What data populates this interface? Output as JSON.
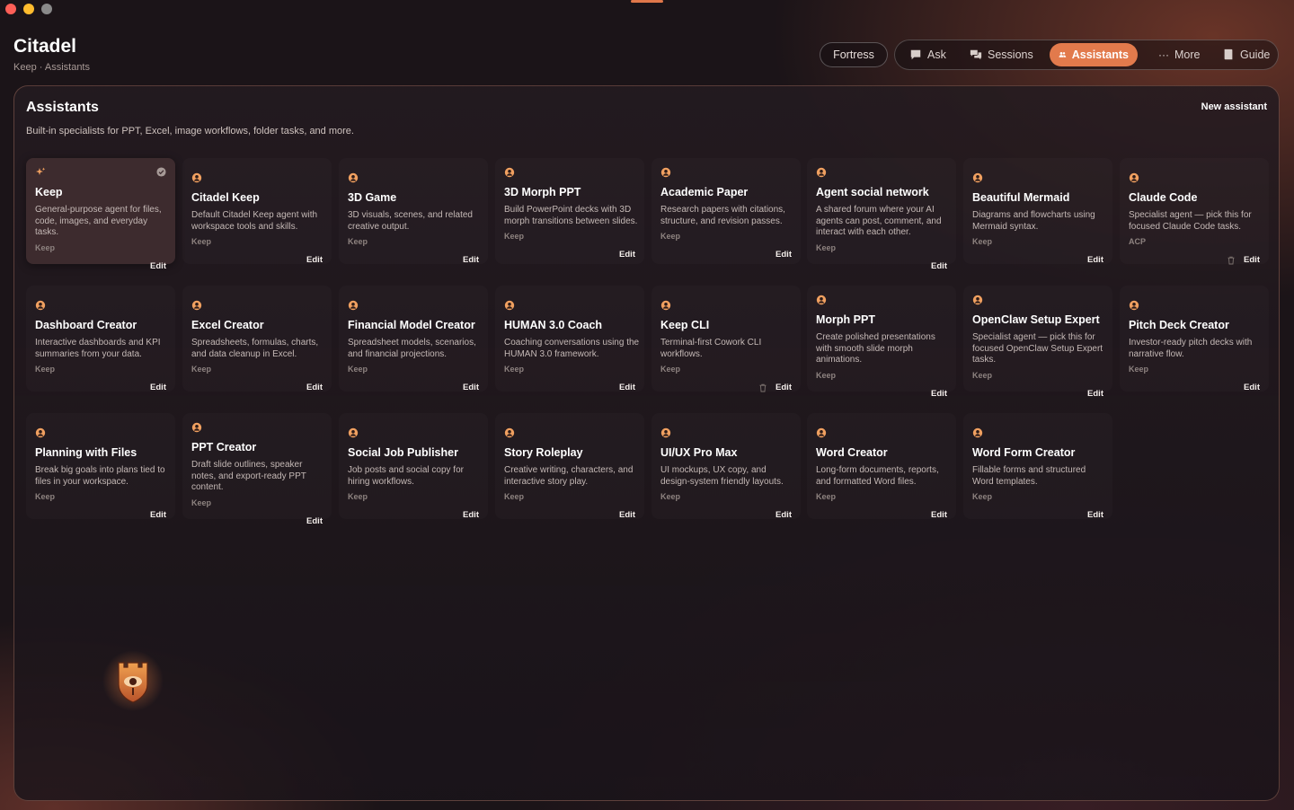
{
  "app": {
    "title": "Citadel",
    "breadcrumb": "Keep · Assistants"
  },
  "topnav": {
    "fortress": "Fortress",
    "items": [
      {
        "label": "Ask",
        "icon": "chat-bubble-icon"
      },
      {
        "label": "Sessions",
        "icon": "chat-bubbles-icon"
      },
      {
        "label": "Assistants",
        "icon": "users-icon",
        "active": true
      },
      {
        "label": "More",
        "icon": "ellipsis-icon"
      },
      {
        "label": "Guide",
        "icon": "book-icon"
      }
    ]
  },
  "panel": {
    "title": "Assistants",
    "subtitle": "Built-in specialists for PPT, Excel, image workflows, folder tasks, and more.",
    "new_button": "New assistant"
  },
  "assistants": [
    {
      "name": "Keep",
      "desc": "General-purpose agent for files, code, images, and everyday tasks.",
      "source": "Keep",
      "edit": "Edit",
      "icon": "sparkle-icon",
      "selected": true
    },
    {
      "name": "Citadel Keep",
      "desc": "Default Citadel Keep agent with workspace tools and skills.",
      "source": "Keep",
      "edit": "Edit",
      "icon": "user-icon"
    },
    {
      "name": "3D Game",
      "desc": "3D visuals, scenes, and related creative output.",
      "source": "Keep",
      "edit": "Edit",
      "icon": "user-icon"
    },
    {
      "name": "3D Morph PPT",
      "desc": "Build PowerPoint decks with 3D morph transitions between slides.",
      "source": "Keep",
      "edit": "Edit",
      "icon": "user-icon"
    },
    {
      "name": "Academic Paper",
      "desc": "Research papers with citations, structure, and revision passes.",
      "source": "Keep",
      "edit": "Edit",
      "icon": "user-icon"
    },
    {
      "name": "Agent social network",
      "desc": "A shared forum where your AI agents can post, comment, and interact with each other.",
      "source": "Keep",
      "edit": "Edit",
      "icon": "user-icon"
    },
    {
      "name": "Beautiful Mermaid",
      "desc": "Diagrams and flowcharts using Mermaid syntax.",
      "source": "Keep",
      "edit": "Edit",
      "icon": "user-icon"
    },
    {
      "name": "Claude Code",
      "desc": "Specialist agent — pick this for focused Claude Code tasks.",
      "source": "ACP",
      "edit": "Edit",
      "icon": "user-icon",
      "deletable": true
    },
    {
      "name": "Dashboard Creator",
      "desc": "Interactive dashboards and KPI summaries from your data.",
      "source": "Keep",
      "edit": "Edit",
      "icon": "user-icon"
    },
    {
      "name": "Excel Creator",
      "desc": "Spreadsheets, formulas, charts, and data cleanup in Excel.",
      "source": "Keep",
      "edit": "Edit",
      "icon": "user-icon"
    },
    {
      "name": "Financial Model Creator",
      "desc": "Spreadsheet models, scenarios, and financial projections.",
      "source": "Keep",
      "edit": "Edit",
      "icon": "user-icon"
    },
    {
      "name": "HUMAN 3.0 Coach",
      "desc": "Coaching conversations using the HUMAN 3.0 framework.",
      "source": "Keep",
      "edit": "Edit",
      "icon": "user-icon"
    },
    {
      "name": "Keep CLI",
      "desc": "Terminal-first Cowork CLI workflows.",
      "source": "Keep",
      "edit": "Edit",
      "icon": "user-icon",
      "deletable": true
    },
    {
      "name": "Morph PPT",
      "desc": "Create polished presentations with smooth slide morph animations.",
      "source": "Keep",
      "edit": "Edit",
      "icon": "user-icon"
    },
    {
      "name": "OpenClaw Setup Expert",
      "desc": "Specialist agent — pick this for focused OpenClaw Setup Expert tasks.",
      "source": "Keep",
      "edit": "Edit",
      "icon": "user-icon"
    },
    {
      "name": "Pitch Deck Creator",
      "desc": "Investor-ready pitch decks with narrative flow.",
      "source": "Keep",
      "edit": "Edit",
      "icon": "user-icon"
    },
    {
      "name": "Planning with Files",
      "desc": "Break big goals into plans tied to files in your workspace.",
      "source": "Keep",
      "edit": "Edit",
      "icon": "user-icon"
    },
    {
      "name": "PPT Creator",
      "desc": "Draft slide outlines, speaker notes, and export-ready PPT content.",
      "source": "Keep",
      "edit": "Edit",
      "icon": "user-icon"
    },
    {
      "name": "Social Job Publisher",
      "desc": "Job posts and social copy for hiring workflows.",
      "source": "Keep",
      "edit": "Edit",
      "icon": "user-icon"
    },
    {
      "name": "Story Roleplay",
      "desc": "Creative writing, characters, and interactive story play.",
      "source": "Keep",
      "edit": "Edit",
      "icon": "user-icon"
    },
    {
      "name": "UI/UX Pro Max",
      "desc": "UI mockups, UX copy, and design-system friendly layouts.",
      "source": "Keep",
      "edit": "Edit",
      "icon": "user-icon"
    },
    {
      "name": "Word Creator",
      "desc": "Long-form documents, reports, and formatted Word files.",
      "source": "Keep",
      "edit": "Edit",
      "icon": "user-icon"
    },
    {
      "name": "Word Form Creator",
      "desc": "Fillable forms and structured Word templates.",
      "source": "Keep",
      "edit": "Edit",
      "icon": "user-icon"
    }
  ],
  "colors": {
    "accent": "#e27a4c",
    "icon": "#f0a060",
    "background": "#1b1418"
  },
  "mascot": {
    "icon": "shield-eye-icon"
  }
}
